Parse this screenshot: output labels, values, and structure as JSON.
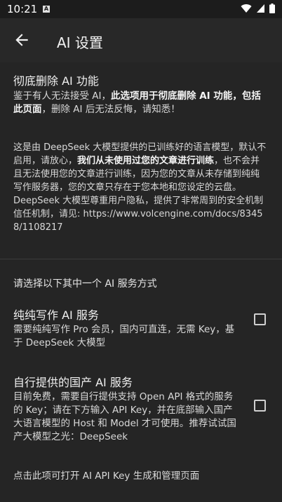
{
  "status": {
    "time": "10:21",
    "badge": "A"
  },
  "toolbar": {
    "title": "AI 设置",
    "back_icon": "arrow-left-icon"
  },
  "delete_section": {
    "title": "彻底删除 AI 功能",
    "desc_plain_1": "鉴于有人无法接受 AI，",
    "desc_bold": "此选项用于彻底删除 AI 功能，包括此页面",
    "desc_plain_2": "，删除 AI 后无法反悔，请知悉！"
  },
  "privacy": {
    "p1_plain_1": "这是由 DeepSeek 大模型提供的已训练好的语言模型，默认不启用，请放心，",
    "p1_bold": "我们从未使用过您的文章进行训练",
    "p1_plain_2": "，也不会并且无法使用您的文章进行训练，因为您的文章从未存储到纯纯写作服务器，您的文章只存在于您本地和您设定的云盘。",
    "p2": "DeepSeek 大模型尊重用户隐私，提供了非常周到的安全机制信任机制，请见: https://www.volcengine.com/docs/83458/1108217"
  },
  "choose_label": "请选择以下其中一个 AI 服务方式",
  "options": [
    {
      "title": "纯纯写作 AI 服务",
      "desc": "需要纯纯写作 Pro 会员，国内可直连，无需 Key，基于 DeepSeek 大模型",
      "checked": false
    },
    {
      "title": "自行提供的国产 AI 服务",
      "desc": "目前免费，需要自行提供支持 Open API 格式的服务的 Key；请在下方输入 API Key，并在底部输入国产大语言模型的 Host 和 Model 才可使用。推荐试试国产大模型之光：DeepSeek",
      "checked": false
    }
  ],
  "api_key_link": "点击此项可打开 AI API Key 生成和管理页面",
  "colors": {
    "background": "#252525",
    "text": "#e8e8e8",
    "divider": "#3c3c3c"
  }
}
